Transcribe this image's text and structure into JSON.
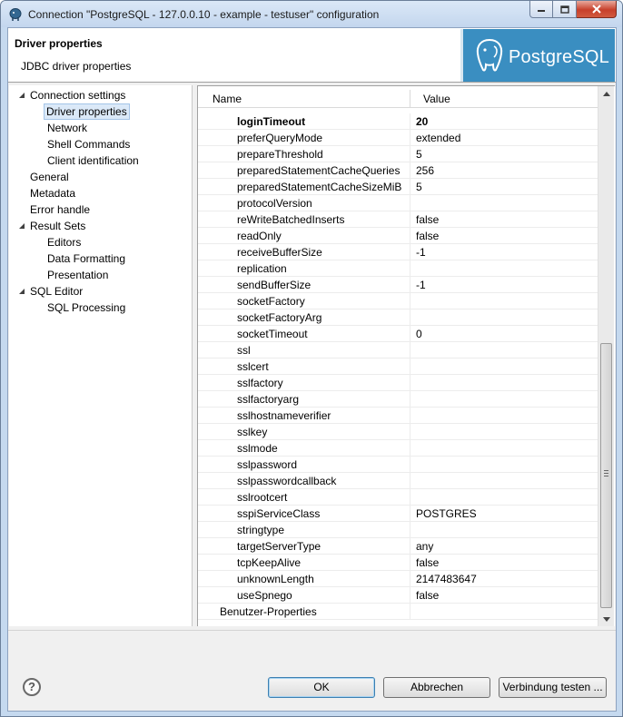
{
  "window": {
    "title": "Connection \"PostgreSQL - 127.0.0.10 - example - testuser\" configuration"
  },
  "header": {
    "title": "Driver properties",
    "subtitle": "JDBC driver properties",
    "logo_text": "PostgreSQL"
  },
  "tree": {
    "items": [
      {
        "label": "Connection settings",
        "level": 0,
        "expandable": true
      },
      {
        "label": "Driver properties",
        "level": 1,
        "selected": true
      },
      {
        "label": "Network",
        "level": 1
      },
      {
        "label": "Shell Commands",
        "level": 1
      },
      {
        "label": "Client identification",
        "level": 1
      },
      {
        "label": "General",
        "level": 0
      },
      {
        "label": "Metadata",
        "level": 0
      },
      {
        "label": "Error handle",
        "level": 0
      },
      {
        "label": "Result Sets",
        "level": 0,
        "expandable": true
      },
      {
        "label": "Editors",
        "level": 1
      },
      {
        "label": "Data Formatting",
        "level": 1
      },
      {
        "label": "Presentation",
        "level": 1
      },
      {
        "label": "SQL Editor",
        "level": 0,
        "expandable": true
      },
      {
        "label": "SQL Processing",
        "level": 1
      }
    ]
  },
  "table": {
    "columns": [
      "Name",
      "Value"
    ],
    "rows": [
      {
        "name": "loginTimeout",
        "value": "20",
        "bold": true
      },
      {
        "name": "preferQueryMode",
        "value": "extended"
      },
      {
        "name": "prepareThreshold",
        "value": "5"
      },
      {
        "name": "preparedStatementCacheQueries",
        "value": "256"
      },
      {
        "name": "preparedStatementCacheSizeMiB",
        "value": "5"
      },
      {
        "name": "protocolVersion",
        "value": ""
      },
      {
        "name": "reWriteBatchedInserts",
        "value": "false"
      },
      {
        "name": "readOnly",
        "value": "false"
      },
      {
        "name": "receiveBufferSize",
        "value": "-1"
      },
      {
        "name": "replication",
        "value": ""
      },
      {
        "name": "sendBufferSize",
        "value": "-1"
      },
      {
        "name": "socketFactory",
        "value": ""
      },
      {
        "name": "socketFactoryArg",
        "value": ""
      },
      {
        "name": "socketTimeout",
        "value": "0"
      },
      {
        "name": "ssl",
        "value": ""
      },
      {
        "name": "sslcert",
        "value": ""
      },
      {
        "name": "sslfactory",
        "value": ""
      },
      {
        "name": "sslfactoryarg",
        "value": ""
      },
      {
        "name": "sslhostnameverifier",
        "value": ""
      },
      {
        "name": "sslkey",
        "value": ""
      },
      {
        "name": "sslmode",
        "value": ""
      },
      {
        "name": "sslpassword",
        "value": ""
      },
      {
        "name": "sslpasswordcallback",
        "value": ""
      },
      {
        "name": "sslrootcert",
        "value": ""
      },
      {
        "name": "sspiServiceClass",
        "value": "POSTGRES"
      },
      {
        "name": "stringtype",
        "value": ""
      },
      {
        "name": "targetServerType",
        "value": "any"
      },
      {
        "name": "tcpKeepAlive",
        "value": "false"
      },
      {
        "name": "unknownLength",
        "value": "2147483647"
      },
      {
        "name": "useSpnego",
        "value": "false"
      },
      {
        "name": "Benutzer-Properties",
        "value": "",
        "group": true
      }
    ]
  },
  "buttons": {
    "ok": "OK",
    "cancel": "Abbrechen",
    "test": "Verbindung testen ...",
    "help": "?"
  },
  "colors": {
    "logo_bg": "#3a8ec1",
    "selection_bg": "#dbe9f8"
  }
}
